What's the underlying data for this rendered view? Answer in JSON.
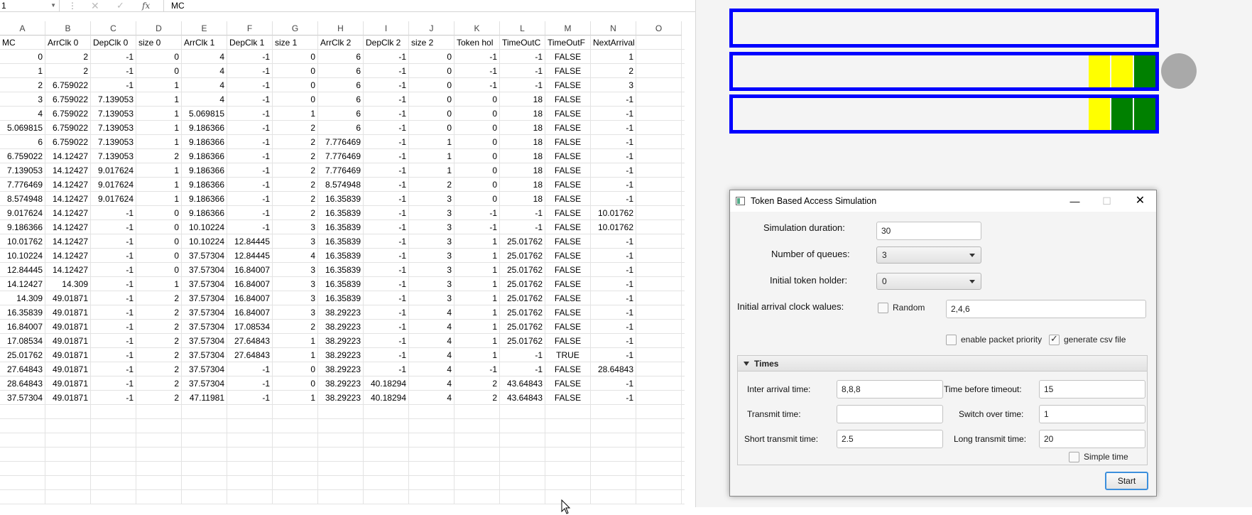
{
  "excel": {
    "name_box": "1",
    "formula_content": "MC",
    "icons": {
      "cancel": "close-icon",
      "enter": "check-icon",
      "function": "fx-icon"
    },
    "columns": [
      "A",
      "B",
      "C",
      "D",
      "E",
      "F",
      "G",
      "H",
      "I",
      "J",
      "K",
      "L",
      "M",
      "N",
      "O"
    ],
    "rows": [
      [
        "MC",
        "ArrClk 0",
        "DepClk 0",
        "size 0",
        "ArrClk 1",
        "DepClk 1",
        "size 1",
        "ArrClk 2",
        "DepClk 2",
        "size 2",
        "Token hol",
        "TimeOutC",
        "TimeOutF",
        "NextArrival",
        ""
      ],
      [
        "0",
        "2",
        "-1",
        "0",
        "4",
        "-1",
        "0",
        "6",
        "-1",
        "0",
        "-1",
        "-1",
        "FALSE",
        "1",
        ""
      ],
      [
        "1",
        "2",
        "-1",
        "0",
        "4",
        "-1",
        "0",
        "6",
        "-1",
        "0",
        "-1",
        "-1",
        "FALSE",
        "2",
        ""
      ],
      [
        "2",
        "6.759022",
        "-1",
        "1",
        "4",
        "-1",
        "0",
        "6",
        "-1",
        "0",
        "-1",
        "-1",
        "FALSE",
        "3",
        ""
      ],
      [
        "3",
        "6.759022",
        "7.139053",
        "1",
        "4",
        "-1",
        "0",
        "6",
        "-1",
        "0",
        "0",
        "18",
        "FALSE",
        "-1",
        ""
      ],
      [
        "4",
        "6.759022",
        "7.139053",
        "1",
        "5.069815",
        "-1",
        "1",
        "6",
        "-1",
        "0",
        "0",
        "18",
        "FALSE",
        "-1",
        ""
      ],
      [
        "5.069815",
        "6.759022",
        "7.139053",
        "1",
        "9.186366",
        "-1",
        "2",
        "6",
        "-1",
        "0",
        "0",
        "18",
        "FALSE",
        "-1",
        ""
      ],
      [
        "6",
        "6.759022",
        "7.139053",
        "1",
        "9.186366",
        "-1",
        "2",
        "7.776469",
        "-1",
        "1",
        "0",
        "18",
        "FALSE",
        "-1",
        ""
      ],
      [
        "6.759022",
        "14.12427",
        "7.139053",
        "2",
        "9.186366",
        "-1",
        "2",
        "7.776469",
        "-1",
        "1",
        "0",
        "18",
        "FALSE",
        "-1",
        ""
      ],
      [
        "7.139053",
        "14.12427",
        "9.017624",
        "1",
        "9.186366",
        "-1",
        "2",
        "7.776469",
        "-1",
        "1",
        "0",
        "18",
        "FALSE",
        "-1",
        ""
      ],
      [
        "7.776469",
        "14.12427",
        "9.017624",
        "1",
        "9.186366",
        "-1",
        "2",
        "8.574948",
        "-1",
        "2",
        "0",
        "18",
        "FALSE",
        "-1",
        ""
      ],
      [
        "8.574948",
        "14.12427",
        "9.017624",
        "1",
        "9.186366",
        "-1",
        "2",
        "16.35839",
        "-1",
        "3",
        "0",
        "18",
        "FALSE",
        "-1",
        ""
      ],
      [
        "9.017624",
        "14.12427",
        "-1",
        "0",
        "9.186366",
        "-1",
        "2",
        "16.35839",
        "-1",
        "3",
        "-1",
        "-1",
        "FALSE",
        "10.01762",
        ""
      ],
      [
        "9.186366",
        "14.12427",
        "-1",
        "0",
        "10.10224",
        "-1",
        "3",
        "16.35839",
        "-1",
        "3",
        "-1",
        "-1",
        "FALSE",
        "10.01762",
        ""
      ],
      [
        "10.01762",
        "14.12427",
        "-1",
        "0",
        "10.10224",
        "12.84445",
        "3",
        "16.35839",
        "-1",
        "3",
        "1",
        "25.01762",
        "FALSE",
        "-1",
        ""
      ],
      [
        "10.10224",
        "14.12427",
        "-1",
        "0",
        "37.57304",
        "12.84445",
        "4",
        "16.35839",
        "-1",
        "3",
        "1",
        "25.01762",
        "FALSE",
        "-1",
        ""
      ],
      [
        "12.84445",
        "14.12427",
        "-1",
        "0",
        "37.57304",
        "16.84007",
        "3",
        "16.35839",
        "-1",
        "3",
        "1",
        "25.01762",
        "FALSE",
        "-1",
        ""
      ],
      [
        "14.12427",
        "14.309",
        "-1",
        "1",
        "37.57304",
        "16.84007",
        "3",
        "16.35839",
        "-1",
        "3",
        "1",
        "25.01762",
        "FALSE",
        "-1",
        ""
      ],
      [
        "14.309",
        "49.01871",
        "-1",
        "2",
        "37.57304",
        "16.84007",
        "3",
        "16.35839",
        "-1",
        "3",
        "1",
        "25.01762",
        "FALSE",
        "-1",
        ""
      ],
      [
        "16.35839",
        "49.01871",
        "-1",
        "2",
        "37.57304",
        "16.84007",
        "3",
        "38.29223",
        "-1",
        "4",
        "1",
        "25.01762",
        "FALSE",
        "-1",
        ""
      ],
      [
        "16.84007",
        "49.01871",
        "-1",
        "2",
        "37.57304",
        "17.08534",
        "2",
        "38.29223",
        "-1",
        "4",
        "1",
        "25.01762",
        "FALSE",
        "-1",
        ""
      ],
      [
        "17.08534",
        "49.01871",
        "-1",
        "2",
        "37.57304",
        "27.64843",
        "1",
        "38.29223",
        "-1",
        "4",
        "1",
        "25.01762",
        "FALSE",
        "-1",
        ""
      ],
      [
        "25.01762",
        "49.01871",
        "-1",
        "2",
        "37.57304",
        "27.64843",
        "1",
        "38.29223",
        "-1",
        "4",
        "1",
        "-1",
        "TRUE",
        "-1",
        ""
      ],
      [
        "27.64843",
        "49.01871",
        "-1",
        "2",
        "37.57304",
        "-1",
        "0",
        "38.29223",
        "-1",
        "4",
        "-1",
        "-1",
        "FALSE",
        "28.64843",
        ""
      ],
      [
        "28.64843",
        "49.01871",
        "-1",
        "2",
        "37.57304",
        "-1",
        "0",
        "38.29223",
        "40.18294",
        "4",
        "2",
        "43.64843",
        "FALSE",
        "-1",
        ""
      ],
      [
        "37.57304",
        "49.01871",
        "-1",
        "2",
        "47.11981",
        "-1",
        "1",
        "38.29223",
        "40.18294",
        "4",
        "2",
        "43.64843",
        "FALSE",
        "-1",
        ""
      ]
    ]
  },
  "visual": {
    "queue_border_color": "#0000ff",
    "packet_yellow": "#ffff00",
    "packet_green": "#008000",
    "token_color": "#a9a9a9",
    "queues": [
      {
        "name": "queue-0",
        "packets": []
      },
      {
        "name": "queue-1",
        "packets": [
          "yellow",
          "yellow",
          "green"
        ]
      },
      {
        "name": "queue-2",
        "packets": [
          "yellow",
          "green",
          "green"
        ]
      }
    ],
    "token_holder_queue": 1
  },
  "dialog": {
    "title": "Token Based Access Simulation",
    "window_icons": {
      "minimize": "minimize-icon",
      "maximize": "maximize-icon",
      "close": "close-icon"
    },
    "simulation_duration_label": "Simulation duration:",
    "simulation_duration_value": "30",
    "number_of_queues_label": "Number of queues:",
    "number_of_queues_value": "3",
    "initial_token_holder_label": "Initial token holder:",
    "initial_token_holder_value": "0",
    "initial_arrival_label": "Initial arrival clock walues:",
    "random_label": "Random",
    "random_checked": false,
    "initial_arrival_value": "2,4,6",
    "enable_priority_label": "enable packet priority",
    "enable_priority_checked": false,
    "generate_csv_label": "generate csv file",
    "generate_csv_checked": true,
    "times": {
      "title": "Times",
      "inter_arrival_label": "Inter arrival time:",
      "inter_arrival_value": "8,8,8",
      "time_before_timeout_label": "Time before timeout:",
      "time_before_timeout_value": "15",
      "transmit_label": "Transmit time:",
      "transmit_value": "",
      "switch_over_label": "Switch over time:",
      "switch_over_value": "1",
      "short_transmit_label": "Short transmit time:",
      "short_transmit_value": "2.5",
      "long_transmit_label": "Long transmit time:",
      "long_transmit_value": "20",
      "simple_time_label": "Simple time",
      "simple_time_checked": false
    },
    "start_label": "Start"
  }
}
